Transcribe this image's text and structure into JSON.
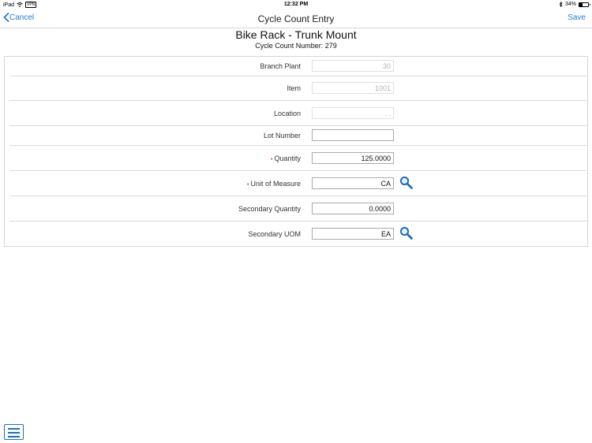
{
  "status_bar": {
    "device": "iPad",
    "vpn": "VPN",
    "time": "12:32 PM",
    "battery_pct_text": "34%",
    "battery_level": 0.34
  },
  "nav": {
    "cancel_label": "Cancel",
    "title": "Cycle Count Entry",
    "save_label": "Save"
  },
  "record": {
    "title": "Bike Rack - Trunk Mount",
    "subtitle": "Cycle Count Number: 279"
  },
  "form": {
    "fields": [
      {
        "label": "Branch Plant",
        "value": "30",
        "readonly": true,
        "required": false
      },
      {
        "label": "Item",
        "value": "1001",
        "readonly": true,
        "required": false
      },
      {
        "label": "Location",
        "value": ". .",
        "readonly": true,
        "required": false
      },
      {
        "label": "Lot Number",
        "value": "",
        "readonly": false,
        "required": false
      },
      {
        "label": "Quantity",
        "value": "125.0000",
        "readonly": false,
        "required": true
      },
      {
        "label": "Unit of Measure",
        "value": "CA",
        "readonly": false,
        "required": true
      },
      {
        "label": "Secondary Quantity",
        "value": "0.0000",
        "readonly": false,
        "required": false
      },
      {
        "label": "Secondary UOM",
        "value": "EA",
        "readonly": false,
        "required": false
      }
    ],
    "required_marker": "•"
  },
  "icons": {
    "back": "chevron-left-icon",
    "lookup": "search-icon",
    "menu": "menu-icon",
    "wifi": "wifi-icon",
    "bluetooth": "bluetooth-icon",
    "battery": "battery-icon"
  },
  "colors": {
    "accent": "#1f7ed6",
    "required": "#c0392b"
  }
}
